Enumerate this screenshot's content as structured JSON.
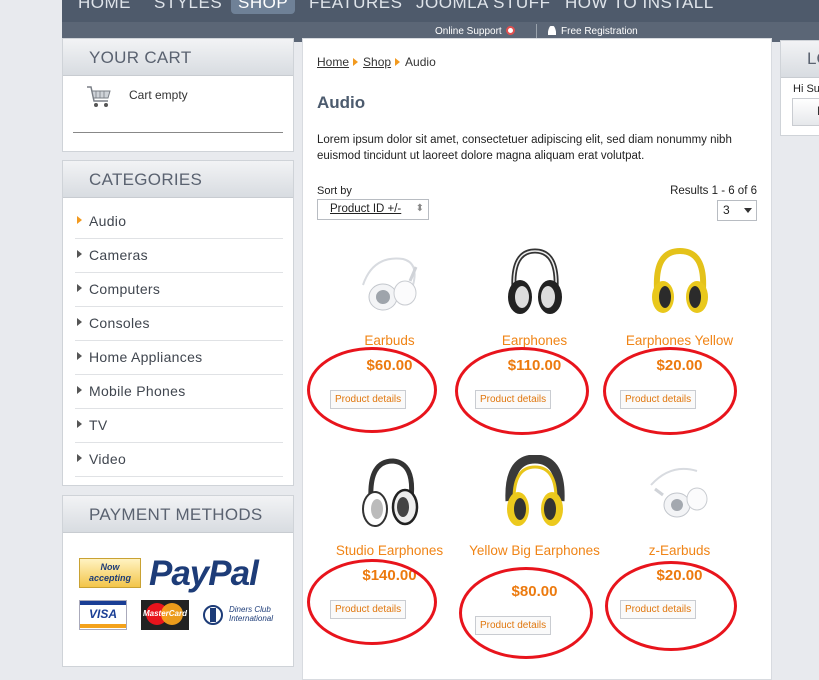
{
  "top_nav": {
    "items": [
      {
        "label": "HOME",
        "active": false
      },
      {
        "label": "STYLES",
        "active": false
      },
      {
        "label": "SHOP",
        "active": true
      },
      {
        "label": "FEATURES",
        "active": false
      },
      {
        "label": "JOOMLA STUFF",
        "active": false
      },
      {
        "label": "HOW TO INSTALL",
        "active": false
      }
    ]
  },
  "sub_bar": {
    "online_support": "Online Support",
    "free_registration": "Free Registration"
  },
  "cart": {
    "title": "YOUR CART",
    "status": "Cart empty"
  },
  "categories": {
    "title": "CATEGORIES",
    "items": [
      {
        "label": "Audio",
        "active": true
      },
      {
        "label": "Cameras",
        "active": false
      },
      {
        "label": "Computers",
        "active": false
      },
      {
        "label": "Consoles",
        "active": false
      },
      {
        "label": "Home Appliances",
        "active": false
      },
      {
        "label": "Mobile Phones",
        "active": false
      },
      {
        "label": "TV",
        "active": false
      },
      {
        "label": "Video",
        "active": false
      }
    ]
  },
  "payment": {
    "title": "PAYMENT METHODS",
    "now_accepting": "Now accepting",
    "paypal": "PayPal",
    "visa": "VISA",
    "mastercard": "MasterCard",
    "diners": "Diners Club International"
  },
  "breadcrumb": {
    "home": "Home",
    "shop": "Shop",
    "current": "Audio"
  },
  "page": {
    "title": "Audio",
    "description": "Lorem ipsum dolor sit amet, consectetuer adipiscing elit, sed diam nonummy nibh euismod tincidunt ut laoreet dolore magna aliquam erat volutpat.",
    "sort_label": "Sort by",
    "sort_value": "Product ID +/-",
    "results": "Results 1 - 6 of 6",
    "per_page": "3"
  },
  "products": [
    {
      "name": "Earbuds",
      "price": "$60.00",
      "button": "Product details"
    },
    {
      "name": "Earphones",
      "price": "$110.00",
      "button": "Product details"
    },
    {
      "name": "Earphones Yellow",
      "price": "$20.00",
      "button": "Product details"
    },
    {
      "name": "Studio Earphones",
      "price": "$140.00",
      "button": "Product details"
    },
    {
      "name": "Yellow Big Earphones",
      "price": "$80.00",
      "button": "Product details"
    },
    {
      "name": "z-Earbuds",
      "price": "$20.00",
      "button": "Product details"
    }
  ],
  "login_box": {
    "title": "LO",
    "greeting": "Hi Su",
    "button": "L"
  },
  "colors": {
    "accent": "#f08416",
    "annotation": "#e8141c",
    "nav": "#4e5a6b",
    "heading": "#4c5b6e"
  }
}
